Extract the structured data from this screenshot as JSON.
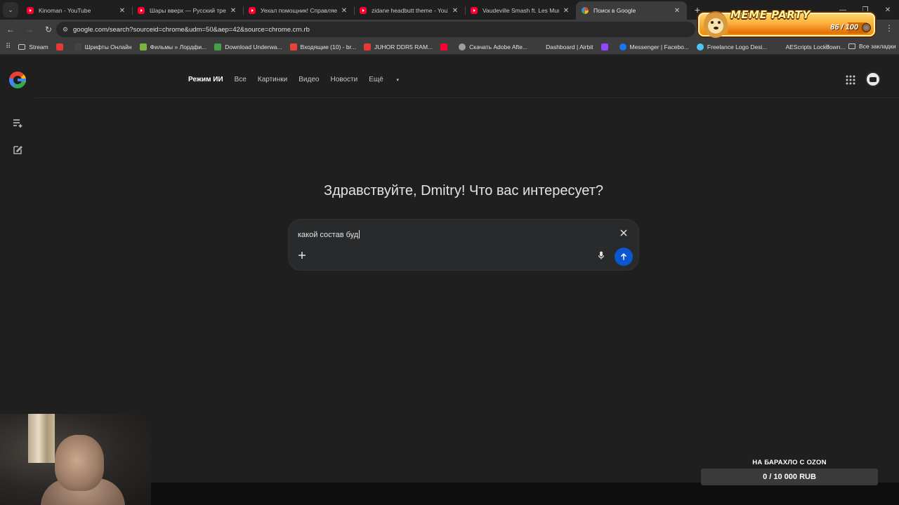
{
  "browser": {
    "tabs": [
      {
        "title": "Kinoman - YouTube",
        "icon": "youtube-icon",
        "active": false
      },
      {
        "title": "Шары вверх — Русский трейл",
        "icon": "youtube-icon",
        "active": false
      },
      {
        "title": "Уехал помощник! Справляем",
        "icon": "youtube-icon",
        "active": false
      },
      {
        "title": "zidane headbutt theme - YouTu",
        "icon": "youtube-icon",
        "active": false
      },
      {
        "title": "Vaudeville Smash ft. Les Murray",
        "icon": "youtube-icon",
        "active": false
      },
      {
        "title": "Поиск в Google",
        "icon": "google-icon",
        "active": true
      }
    ],
    "url": "google.com/search?sourceid=chrome&udm=50&aep=42&source=chrome.crn.rb",
    "bookmarks": [
      {
        "label": "Stream",
        "icon": "folder-icon",
        "color": "#c7c7c7"
      },
      {
        "label": "",
        "icon": "live-icon",
        "color": "#e53935"
      },
      {
        "label": "Шрифты Онлайн",
        "icon": "font-icon",
        "color": "#444444"
      },
      {
        "label": "Фильмы » Лордфи...",
        "icon": "film-icon",
        "color": "#7cb342"
      },
      {
        "label": "Download Underwa...",
        "icon": "download-icon",
        "color": "#43a047"
      },
      {
        "label": "Входящие (10) - br...",
        "icon": "gmail-icon",
        "color": "#ea4335"
      },
      {
        "label": "JUHOR DDR5 RAM...",
        "icon": "shop-icon",
        "color": "#e53935"
      },
      {
        "label": "",
        "icon": "youtube-icon",
        "color": "#ff0033"
      },
      {
        "label": "Скачать Adobe Afte...",
        "icon": "globe-icon",
        "color": "#9e9e9e"
      },
      {
        "label": "Dashboard | Airbit",
        "icon": "airbit-icon",
        "color": "#3c3c3c"
      },
      {
        "label": "",
        "icon": "twitch-icon",
        "color": "#9146ff"
      },
      {
        "label": "Messenger | Facebo...",
        "icon": "facebook-icon",
        "color": "#1877f2"
      },
      {
        "label": "Freelance Logo Desi...",
        "icon": "gear-icon",
        "color": "#4fc3f7"
      },
      {
        "label": "AEScripts Lockdown...",
        "icon": "aescripts-icon",
        "color": "#3c3c3c"
      }
    ],
    "all_bookmarks_label": "Все закладки"
  },
  "overlay": {
    "meme_title": "MEME PARTY",
    "meme_count": "86 / 100",
    "meme_progress": 0.86,
    "goal_title": "НА БАРАХЛО С OZON",
    "goal_value": "0 / 10 000 RUB"
  },
  "google": {
    "nav": [
      "Режим ИИ",
      "Все",
      "Картинки",
      "Видео",
      "Новости",
      "Ещё"
    ],
    "greeting": "Здравствуйте, Dmitry! Что вас интересует?",
    "query": "какой состав буд",
    "accent": "#0b57d0"
  }
}
